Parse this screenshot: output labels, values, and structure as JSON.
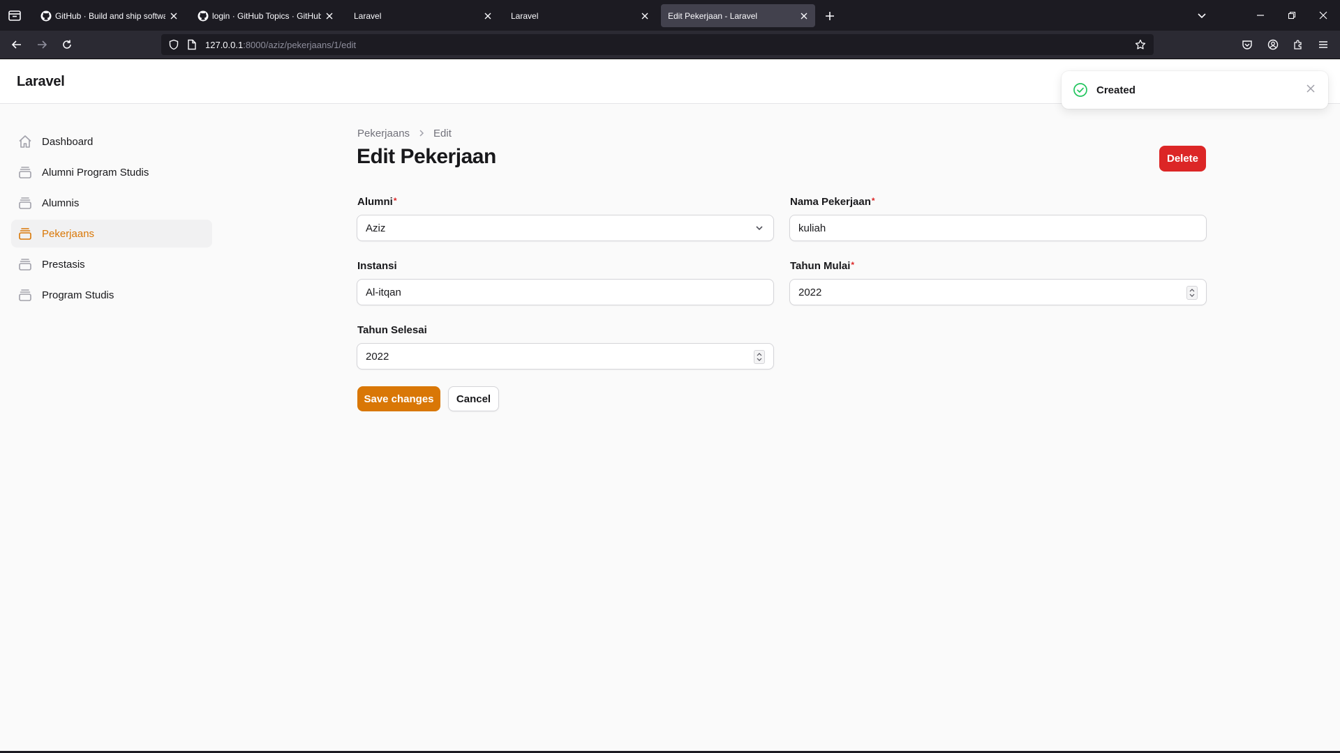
{
  "browser": {
    "tabs": [
      {
        "title": "GitHub · Build and ship software",
        "icon": "github-icon",
        "active": false
      },
      {
        "title": "login · GitHub Topics · GitHub",
        "icon": "github-icon",
        "active": false
      },
      {
        "title": "Laravel",
        "icon": "",
        "active": false
      },
      {
        "title": "Laravel",
        "icon": "",
        "active": false
      },
      {
        "title": "Edit Pekerjaan - Laravel",
        "icon": "",
        "active": true
      }
    ],
    "url_host": "127.0.0.1",
    "url_path": ":8000/aziz/pekerjaans/1/edit"
  },
  "app": {
    "brand": "Laravel"
  },
  "sidebar": {
    "items": [
      {
        "label": "Dashboard",
        "icon": "home-icon",
        "active": false
      },
      {
        "label": "Alumni Program Studis",
        "icon": "rectangle-stack-icon",
        "active": false
      },
      {
        "label": "Alumnis",
        "icon": "rectangle-stack-icon",
        "active": false
      },
      {
        "label": "Pekerjaans",
        "icon": "rectangle-stack-icon",
        "active": true
      },
      {
        "label": "Prestasis",
        "icon": "rectangle-stack-icon",
        "active": false
      },
      {
        "label": "Program Studis",
        "icon": "rectangle-stack-icon",
        "active": false
      }
    ]
  },
  "breadcrumb": {
    "parent": "Pekerjaans",
    "current": "Edit"
  },
  "page": {
    "title": "Edit Pekerjaan",
    "delete_label": "Delete"
  },
  "form": {
    "alumni": {
      "label": "Alumni",
      "value": "Aziz",
      "required": true
    },
    "nama_pekerjaan": {
      "label": "Nama Pekerjaan",
      "value": "kuliah",
      "required": true
    },
    "instansi": {
      "label": "Instansi",
      "value": "Al-itqan",
      "required": false
    },
    "tahun_mulai": {
      "label": "Tahun Mulai",
      "value": "2022",
      "required": true
    },
    "tahun_selesai": {
      "label": "Tahun Selesai",
      "value": "2022",
      "required": false
    },
    "required_marker": "*",
    "save_label": "Save changes",
    "cancel_label": "Cancel"
  },
  "toast": {
    "message": "Created",
    "icon": "check-circle-icon"
  },
  "colors": {
    "primary": "#d97706",
    "danger": "#dc2626",
    "success": "#22c55e"
  }
}
